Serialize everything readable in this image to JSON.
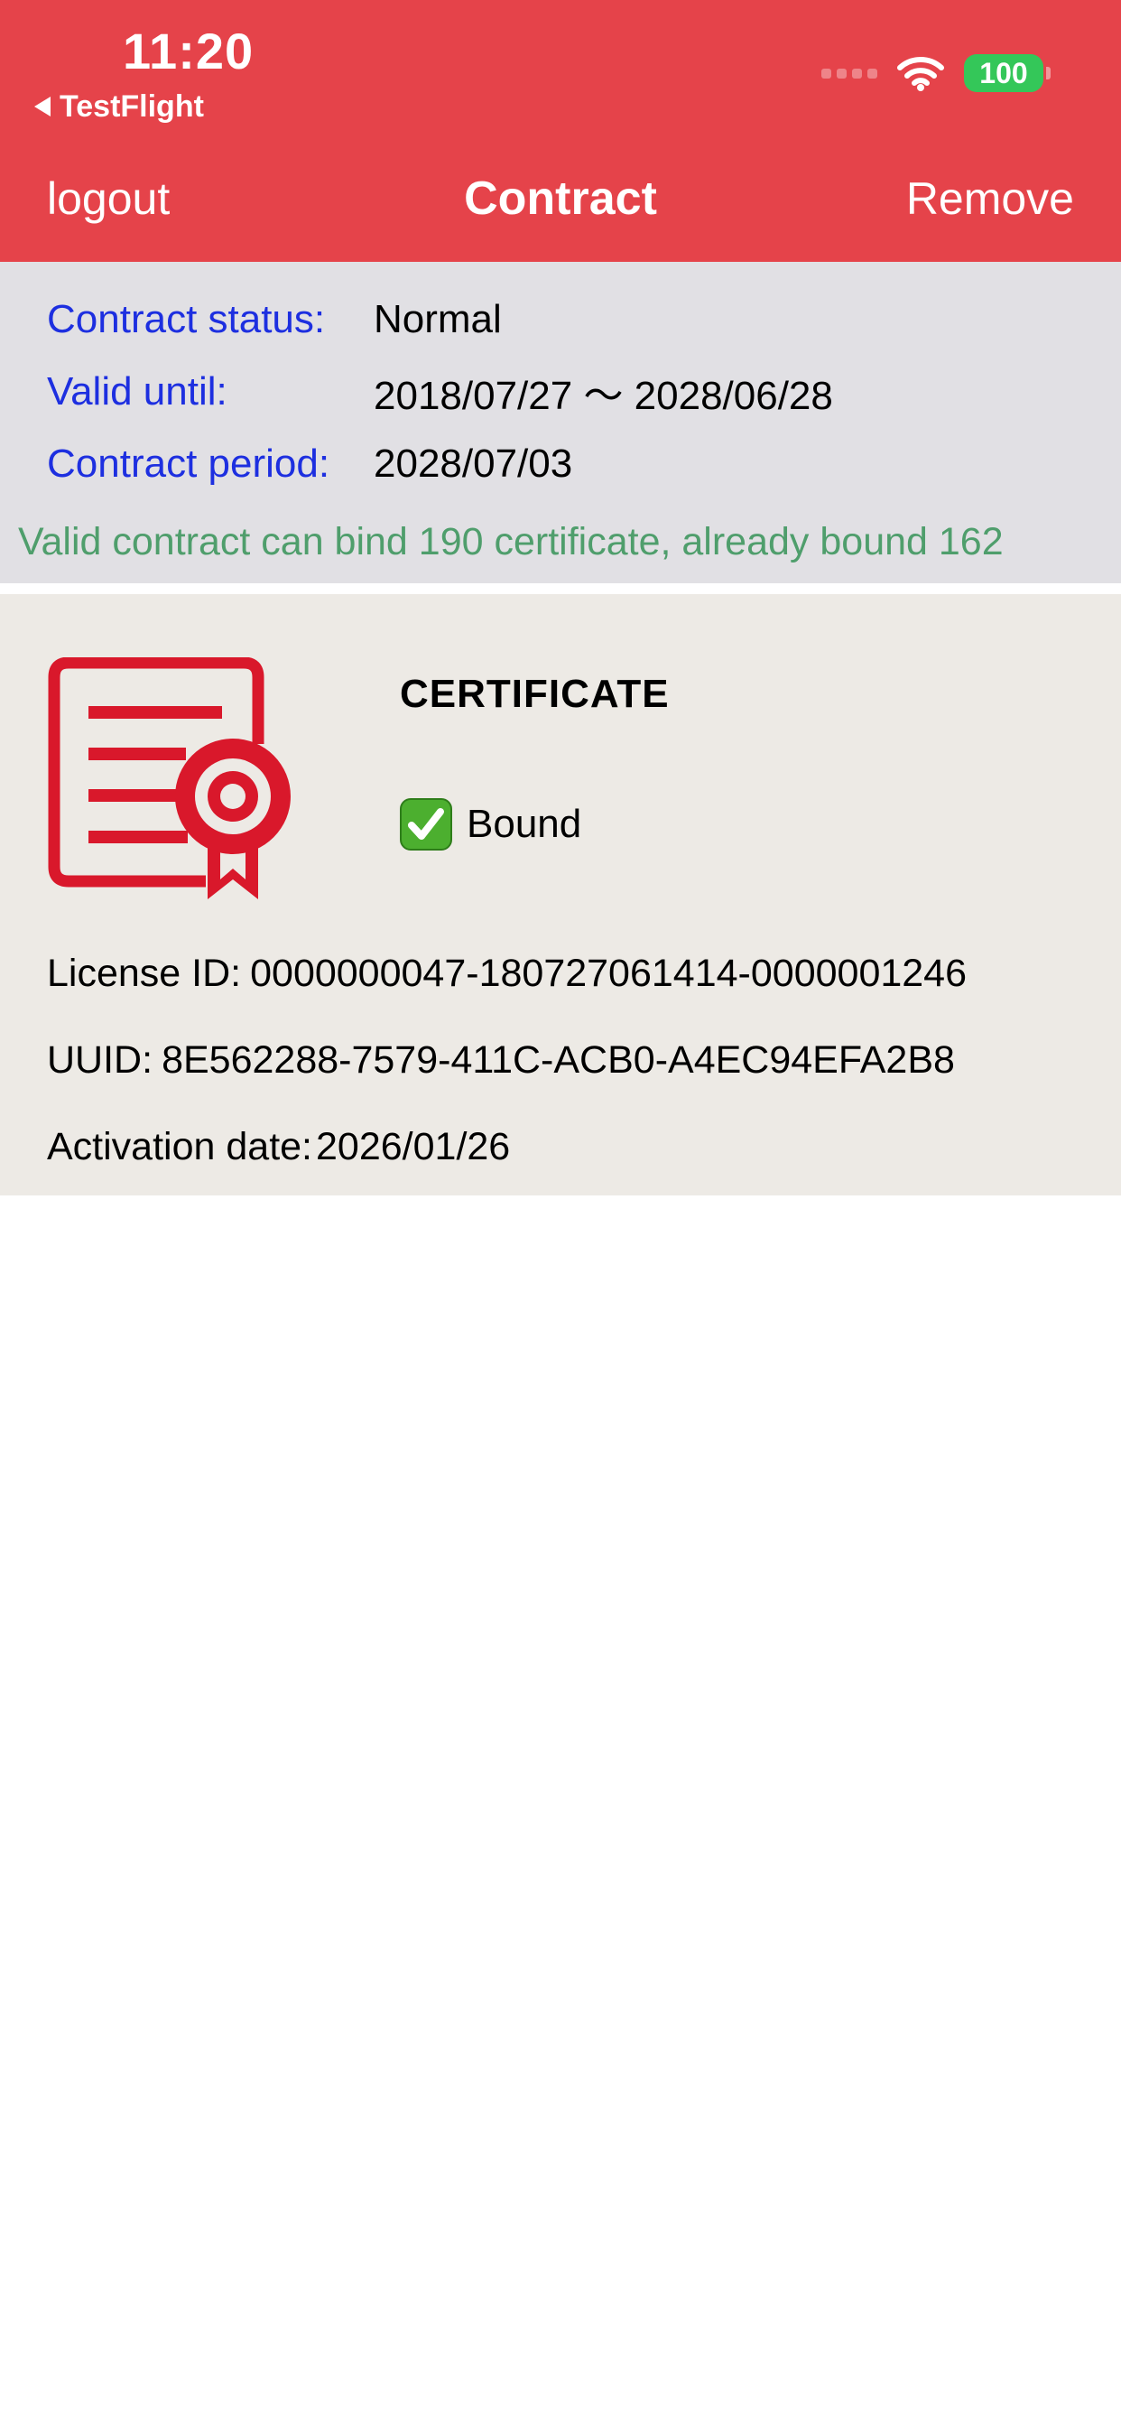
{
  "status_bar": {
    "time": "11:20",
    "back_app": "TestFlight",
    "battery_level": "100",
    "icons": [
      "signal-dots-icon",
      "wifi-icon",
      "battery-icon"
    ]
  },
  "nav": {
    "left_label": "logout",
    "title": "Contract",
    "right_label": "Remove"
  },
  "contract": {
    "rows": [
      {
        "label": "Contract status:",
        "value": "Normal"
      },
      {
        "label": "Valid until:",
        "value": "2018/07/27 〜 2028/06/28"
      },
      {
        "label": "Contract period:",
        "value": "2028/07/03"
      }
    ],
    "bind_summary": "Valid contract can bind 190 certificate, already bound 162"
  },
  "certificate": {
    "icon": "certificate-icon",
    "title": "CERTIFICATE",
    "status_icon": "checkmark-icon",
    "status_label": "Bound",
    "details": [
      {
        "key": "License ID:",
        "value": "0000000047-180727061414-0000001246"
      },
      {
        "key": "UUID:",
        "value": "8E562288-7579-411C-ACB0-A4EC94EFA2B8"
      },
      {
        "key": "Activation date:",
        "value": "2026/01/26"
      }
    ]
  },
  "colors": {
    "header_bg": "#E5434A",
    "label_blue": "#1D2FE0",
    "summary_green": "#4F9E6C",
    "contract_panel_bg": "#E1E0E4",
    "certificate_bg": "#EDEAE5",
    "icon_red": "#D9182B",
    "battery_green": "#34C759"
  }
}
